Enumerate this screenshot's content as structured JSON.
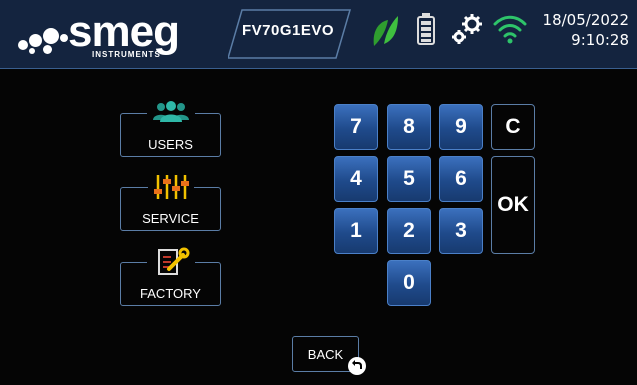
{
  "header": {
    "brand": "smeg",
    "brand_sub": "INSTRUMENTS",
    "model": "FV70G1EVO",
    "date": "18/05/2022",
    "time": "9:10:28",
    "status_icons": [
      "eco-leaf-icon",
      "battery-icon",
      "gears-icon",
      "wifi-icon"
    ]
  },
  "menu": {
    "users": "USERS",
    "service": "SERVICE",
    "factory": "FACTORY"
  },
  "keypad": {
    "k7": "7",
    "k8": "8",
    "k9": "9",
    "k4": "4",
    "k5": "5",
    "k6": "6",
    "k1": "1",
    "k2": "2",
    "k3": "3",
    "k0": "0",
    "clear": "C",
    "ok": "OK"
  },
  "back": "BACK",
  "colors": {
    "header_bg": "#14243f",
    "key_blue": "#2a5aa3",
    "accent_green": "#3db23d",
    "users_teal": "#2aa89a",
    "slider_yellow": "#f2c200",
    "wifi_green": "#2ec46a"
  }
}
